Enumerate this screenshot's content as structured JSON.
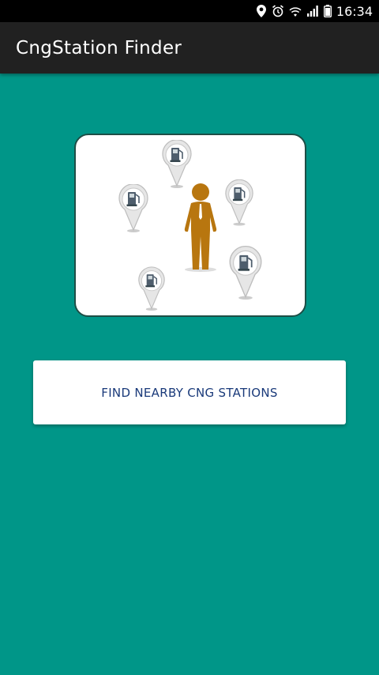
{
  "status_bar": {
    "time": "16:34",
    "icons": [
      "location-icon",
      "alarm-icon",
      "wifi-icon",
      "signal-icon",
      "battery-icon"
    ]
  },
  "app_bar": {
    "title": "CngStation Finder"
  },
  "main": {
    "illustration": {
      "icons": [
        "person-icon",
        "fuel-pin-icon"
      ]
    },
    "find_button_label": "FIND NEARBY CNG STATIONS"
  },
  "colors": {
    "background": "#009688",
    "app_bar": "#212121",
    "status_bar": "#000000",
    "person": "#b8760f",
    "button_text": "#1a3a7a"
  }
}
